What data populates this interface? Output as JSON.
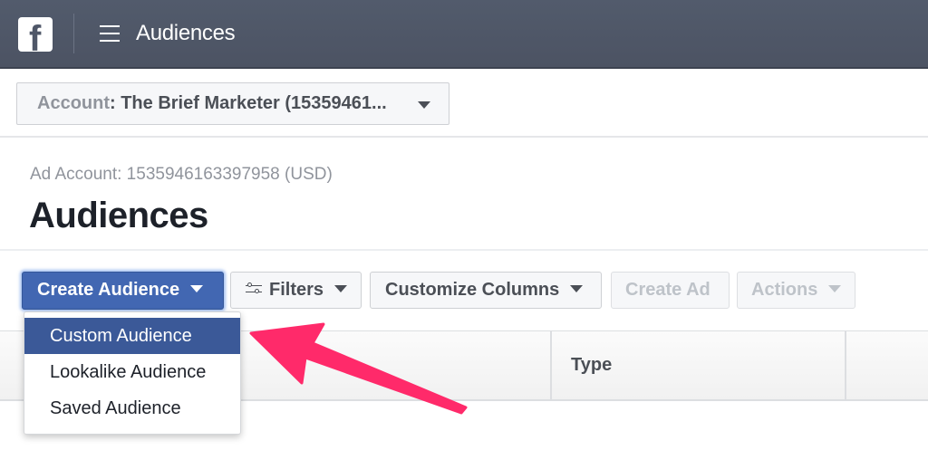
{
  "topbar": {
    "logo_icon": "facebook-logo",
    "menu_icon": "hamburger-icon",
    "title": "Audiences"
  },
  "account_selector": {
    "label": "Account",
    "separator": ": ",
    "value": "The Brief Marketer (15359461...",
    "icon": "caret-down-icon"
  },
  "header": {
    "ad_account": "Ad Account: 1535946163397958 (USD)",
    "title": "Audiences"
  },
  "toolbar": {
    "create_audience": "Create Audience",
    "filters": "Filters",
    "customize_columns": "Customize Columns",
    "create_ad": "Create Ad",
    "actions": "Actions"
  },
  "create_audience_menu": {
    "items": [
      {
        "label": "Custom Audience",
        "highlighted": true
      },
      {
        "label": "Lookalike Audience",
        "highlighted": false
      },
      {
        "label": "Saved Audience",
        "highlighted": false
      }
    ]
  },
  "table": {
    "columns": [
      "",
      "Type",
      ""
    ]
  },
  "annotation": {
    "type": "arrow",
    "color": "#ff2a6a",
    "points_to": "Custom Audience"
  },
  "colors": {
    "topbar": "#4f5768",
    "primary_button": "#4267b2",
    "menu_highlight": "#3b5998"
  }
}
